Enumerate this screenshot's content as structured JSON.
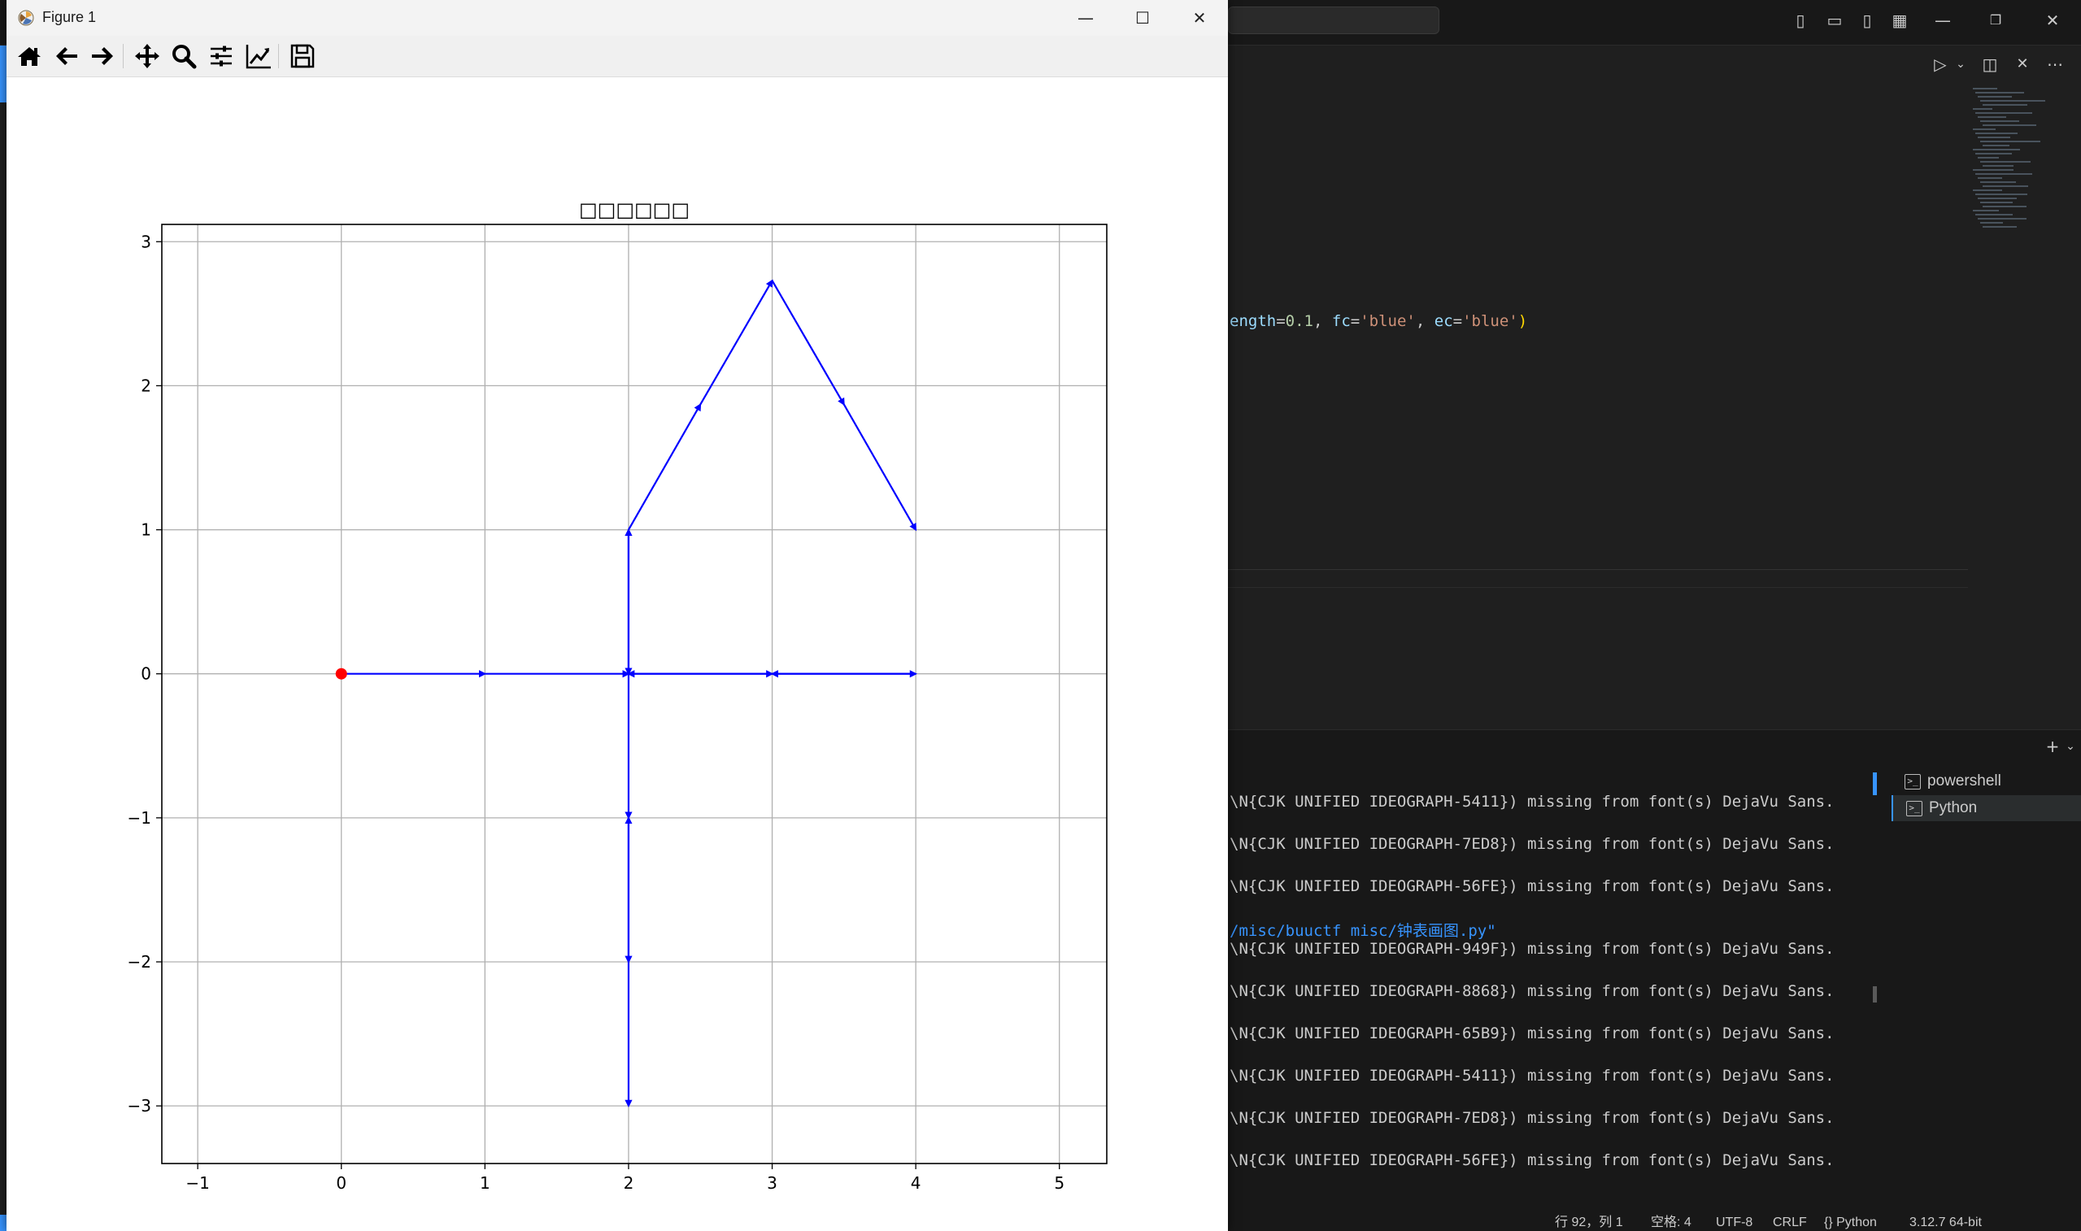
{
  "figure_window": {
    "title": "Figure 1",
    "buttons": {
      "minimize": "—",
      "maximize": "☐",
      "close": "✕"
    },
    "toolbar": [
      "home-icon",
      "back-icon",
      "forward-icon",
      "pan-icon",
      "zoom-icon",
      "configure-subplots-icon",
      "edit-axes-icon",
      "save-icon"
    ]
  },
  "chart_data": {
    "type": "line",
    "title": "□□□□□□",
    "xlabel": "",
    "ylabel": "",
    "xlim": [
      -1.25,
      5.33
    ],
    "ylim": [
      -3.4,
      3.12
    ],
    "xticks": [
      "−1",
      "0",
      "1",
      "2",
      "3",
      "4",
      "5"
    ],
    "xtick_values": [
      -1,
      0,
      1,
      2,
      3,
      4,
      5
    ],
    "yticks": [
      "−3",
      "−2",
      "−1",
      "0",
      "1",
      "2",
      "3"
    ],
    "ytick_values": [
      -3,
      -2,
      -1,
      0,
      1,
      2,
      3
    ],
    "grid": true,
    "origin_point": {
      "x": 0,
      "y": 0,
      "color": "#ff0000"
    },
    "arrow_color": "#0000ff",
    "arrows": [
      {
        "from": [
          0,
          0
        ],
        "to": [
          1,
          0
        ]
      },
      {
        "from": [
          1,
          0
        ],
        "to": [
          2,
          0
        ]
      },
      {
        "from": [
          2,
          0
        ],
        "to": [
          3,
          0
        ]
      },
      {
        "from": [
          3,
          0
        ],
        "to": [
          4,
          0
        ]
      },
      {
        "from": [
          4,
          0
        ],
        "to": [
          3,
          0
        ]
      },
      {
        "from": [
          3,
          0
        ],
        "to": [
          2,
          0
        ]
      },
      {
        "from": [
          2,
          0
        ],
        "to": [
          2,
          1
        ]
      },
      {
        "from": [
          2,
          1
        ],
        "to": [
          2.5,
          1.87
        ]
      },
      {
        "from": [
          2.5,
          1.87
        ],
        "to": [
          3,
          2.73
        ]
      },
      {
        "from": [
          3,
          2.73
        ],
        "to": [
          3.5,
          1.87
        ]
      },
      {
        "from": [
          3.5,
          1.87
        ],
        "to": [
          4,
          1
        ]
      },
      {
        "from": [
          2,
          1
        ],
        "to": [
          2,
          0
        ]
      },
      {
        "from": [
          2,
          0
        ],
        "to": [
          2,
          -1
        ]
      },
      {
        "from": [
          2,
          -1
        ],
        "to": [
          2,
          -2
        ]
      },
      {
        "from": [
          2,
          -2
        ],
        "to": [
          2,
          -1
        ]
      },
      {
        "from": [
          2,
          -2
        ],
        "to": [
          2,
          -3
        ]
      }
    ]
  },
  "editor": {
    "code_fragment": [
      {
        "t": "ength",
        "c": "par"
      },
      {
        "t": "=",
        "c": "pun"
      },
      {
        "t": "0.1",
        "c": "num"
      },
      {
        "t": ", ",
        "c": "pun"
      },
      {
        "t": "fc",
        "c": "par"
      },
      {
        "t": "=",
        "c": "pun"
      },
      {
        "t": "'blue'",
        "c": "str"
      },
      {
        "t": ", ",
        "c": "pun"
      },
      {
        "t": "ec",
        "c": "par"
      },
      {
        "t": "=",
        "c": "pun"
      },
      {
        "t": "'blue'",
        "c": "str"
      },
      {
        "t": ")",
        "c": "brk"
      }
    ]
  },
  "terminal": {
    "lines": [
      {
        "text": "\\N{CJK UNIFIED IDEOGRAPH-5411}) missing from font(s) DejaVu Sans.",
        "kind": "out"
      },
      {
        "text": "\\N{CJK UNIFIED IDEOGRAPH-7ED8}) missing from font(s) DejaVu Sans.",
        "kind": "out"
      },
      {
        "text": "\\N{CJK UNIFIED IDEOGRAPH-56FE}) missing from font(s) DejaVu Sans.",
        "kind": "out"
      },
      {
        "text": "/misc/buuctf misc/钟表画图.py\"",
        "kind": "path"
      },
      {
        "text": "\\N{CJK UNIFIED IDEOGRAPH-949F}) missing from font(s) DejaVu Sans.",
        "kind": "out"
      },
      {
        "text": "\\N{CJK UNIFIED IDEOGRAPH-8868}) missing from font(s) DejaVu Sans.",
        "kind": "out"
      },
      {
        "text": "\\N{CJK UNIFIED IDEOGRAPH-65B9}) missing from font(s) DejaVu Sans.",
        "kind": "out"
      },
      {
        "text": "\\N{CJK UNIFIED IDEOGRAPH-5411}) missing from font(s) DejaVu Sans.",
        "kind": "out"
      },
      {
        "text": "\\N{CJK UNIFIED IDEOGRAPH-7ED8}) missing from font(s) DejaVu Sans.",
        "kind": "out"
      },
      {
        "text": "\\N{CJK UNIFIED IDEOGRAPH-56FE}) missing from font(s) DejaVu Sans.",
        "kind": "out"
      }
    ],
    "instances": [
      {
        "label": "powershell",
        "active": false
      },
      {
        "label": "Python",
        "active": true
      }
    ]
  },
  "statusbar": {
    "ln_col": "行 92，列 1",
    "spaces": "空格: 4",
    "encoding": "UTF-8",
    "eol": "CRLF",
    "language": "{} Python",
    "interpreter": "3.12.7 64-bit"
  }
}
